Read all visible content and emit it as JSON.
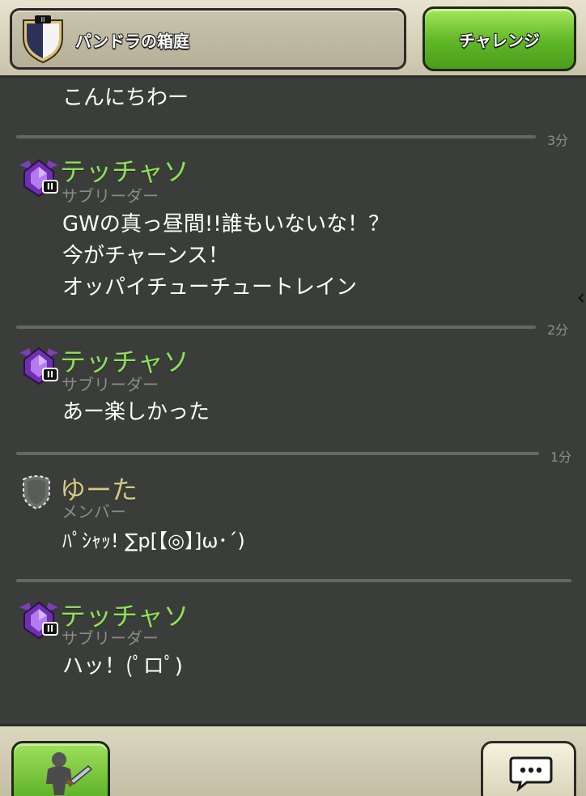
{
  "header": {
    "clan_name": "パンドラの箱庭",
    "challenge_label": "チャレンジ"
  },
  "messages": [
    {
      "lines": [
        "こんにちわー"
      ]
    },
    {
      "divider_time": "3分"
    },
    {
      "author": "テッチャソ",
      "role": "サブリーダー",
      "lines": [
        "GWの真っ昼間!!誰もいないな！？",
        "今がチャーンス！",
        "オッパイチューチュートレイン"
      ]
    },
    {
      "divider_time": "2分"
    },
    {
      "author": "テッチャソ",
      "role": "サブリーダー",
      "lines": [
        "あー楽しかった"
      ]
    },
    {
      "divider_time": "1分"
    },
    {
      "author": "ゆーた",
      "role": "メンバー",
      "lines": [
        "ﾊﾟｼｬｯ! ∑p[【◎】]ω･´)"
      ]
    },
    {
      "divider_time": ""
    },
    {
      "author": "テッチャソ",
      "role": "サブリーダー",
      "lines": [
        "ハッ！(ﾟロﾟ)"
      ]
    }
  ],
  "rank_pause_tag": "II",
  "colors": {
    "accent_green": "#8fe05c",
    "member_gold": "#d6c88a",
    "background": "#3a3d39"
  },
  "icons": {
    "clan_badge": "clan-shield-icon",
    "rank_badge": "purple-crystal-league-icon",
    "member_badge": "empty-shield-icon",
    "attack": "barbarian-sword-icon",
    "chat": "speech-bubble-icon"
  }
}
